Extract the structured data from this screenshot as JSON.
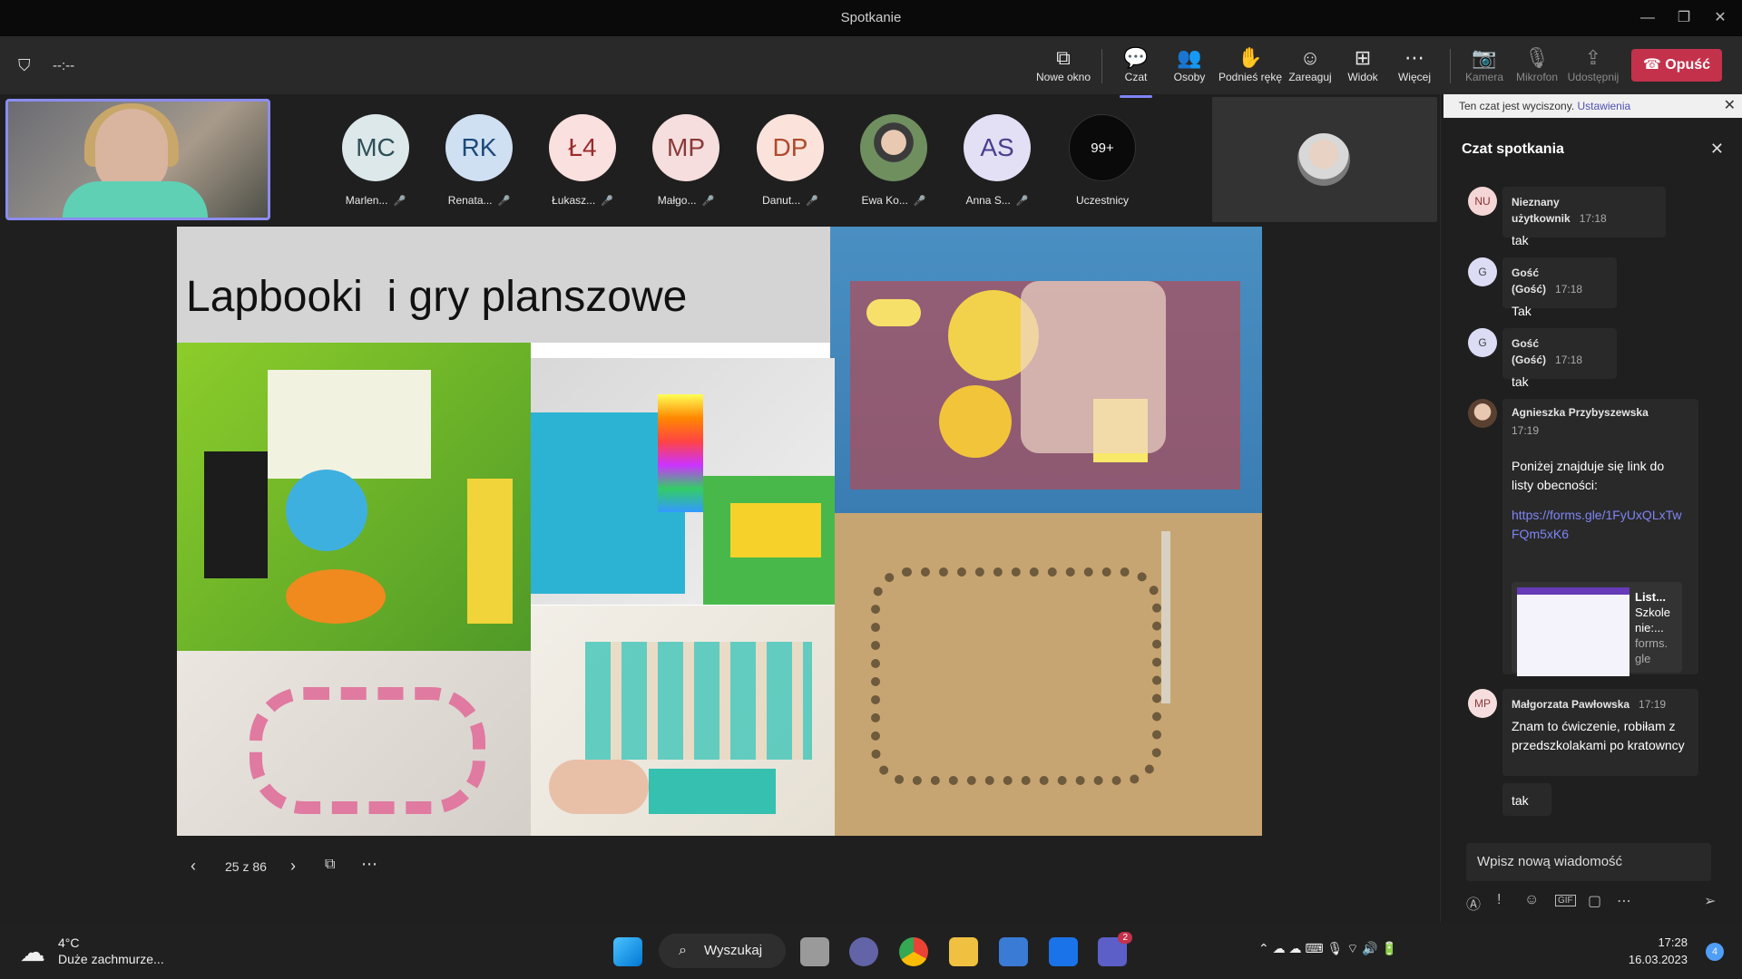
{
  "window": {
    "title": "Spotkanie",
    "min": "—",
    "restore": "❐",
    "close": "✕"
  },
  "toolbar": {
    "timer": "--:--",
    "shield_icon": "shield-icon",
    "buttons": [
      {
        "label": "Nowe okno",
        "icon": "⧉"
      },
      {
        "label": "Czat",
        "icon": "💬"
      },
      {
        "label": "Osoby",
        "icon": "👥"
      },
      {
        "label": "Podnieś rękę",
        "icon": "✋"
      },
      {
        "label": "Zareaguj",
        "icon": "☺"
      },
      {
        "label": "Widok",
        "icon": "⊞"
      },
      {
        "label": "Więcej",
        "icon": "⋯"
      },
      {
        "label": "Kamera",
        "icon": "📷"
      },
      {
        "label": "Mikrofon",
        "icon": "🎙"
      },
      {
        "label": "Udostępnij",
        "icon": "⇪"
      }
    ],
    "leave_label": "Opuść",
    "accent": "#7f85f5",
    "leave_color": "#c4314b"
  },
  "participants": [
    {
      "initials": "MC",
      "name": "Marlen...",
      "bg": "#dce8ea",
      "fg": "#2f4f58"
    },
    {
      "initials": "RK",
      "name": "Renata...",
      "bg": "#cfe0f3",
      "fg": "#1d4a7a"
    },
    {
      "initials": "Ł4",
      "name": "Łukasz...",
      "bg": "#fbe0e0",
      "fg": "#9a2a2a"
    },
    {
      "initials": "MP",
      "name": "Małgo...",
      "bg": "#f6dede",
      "fg": "#8a3a3a"
    },
    {
      "initials": "DP",
      "name": "Danut...",
      "bg": "#fbe3dc",
      "fg": "#b04a2a"
    },
    {
      "initials": "",
      "name": "Ewa Ko...",
      "bg": "#8a9aa0",
      "fg": "#fff"
    },
    {
      "initials": "AS",
      "name": "Anna S...",
      "bg": "#e3e0f5",
      "fg": "#4a4090"
    },
    {
      "initials": "99+",
      "name": "Uczestnicy",
      "bg": "#0a0a0a",
      "fg": "#fff"
    }
  ],
  "slide": {
    "title": "Lapbooki  i gry planszowe",
    "counter": "25 z 86"
  },
  "chat": {
    "muted_text": "Ten czat jest wyciszony.",
    "muted_link": "Ustawienia",
    "title": "Czat spotkania",
    "messages": [
      {
        "avatar": "NU",
        "name": "Nieznany użytkownik",
        "time": "17:18",
        "text": "tak"
      },
      {
        "avatar": "G",
        "name": "Gość (Gość)",
        "time": "17:18",
        "text": "Tak"
      },
      {
        "avatar": "G",
        "name": "Gość (Gość)",
        "time": "17:18",
        "text": "tak"
      },
      {
        "avatar": "",
        "name": "Agnieszka Przybyszewska",
        "time": "17:19",
        "text": "Poniżej znajduje się link do listy obecności:",
        "link": "https://forms.gle/1FyUxQLxTwFQm5xK6",
        "card_title": "List...",
        "card_sub": "Szkole nie:...",
        "card_domain": "forms. gle"
      },
      {
        "avatar": "MP",
        "name": "Małgorzata Pawłowska",
        "time": "17:19",
        "text": "Znam to ćwiczenie, robiłam z przedszkolakami po kratowncy",
        "extra": "tak"
      }
    ],
    "compose_placeholder": "Wpisz nową wiadomość"
  },
  "taskbar": {
    "temp": "4°C",
    "weather": "Duże zachmurze...",
    "search": "Wyszukaj",
    "time": "17:28",
    "date": "16.03.2023",
    "teams_badge": "2",
    "notif_badge": "4"
  }
}
